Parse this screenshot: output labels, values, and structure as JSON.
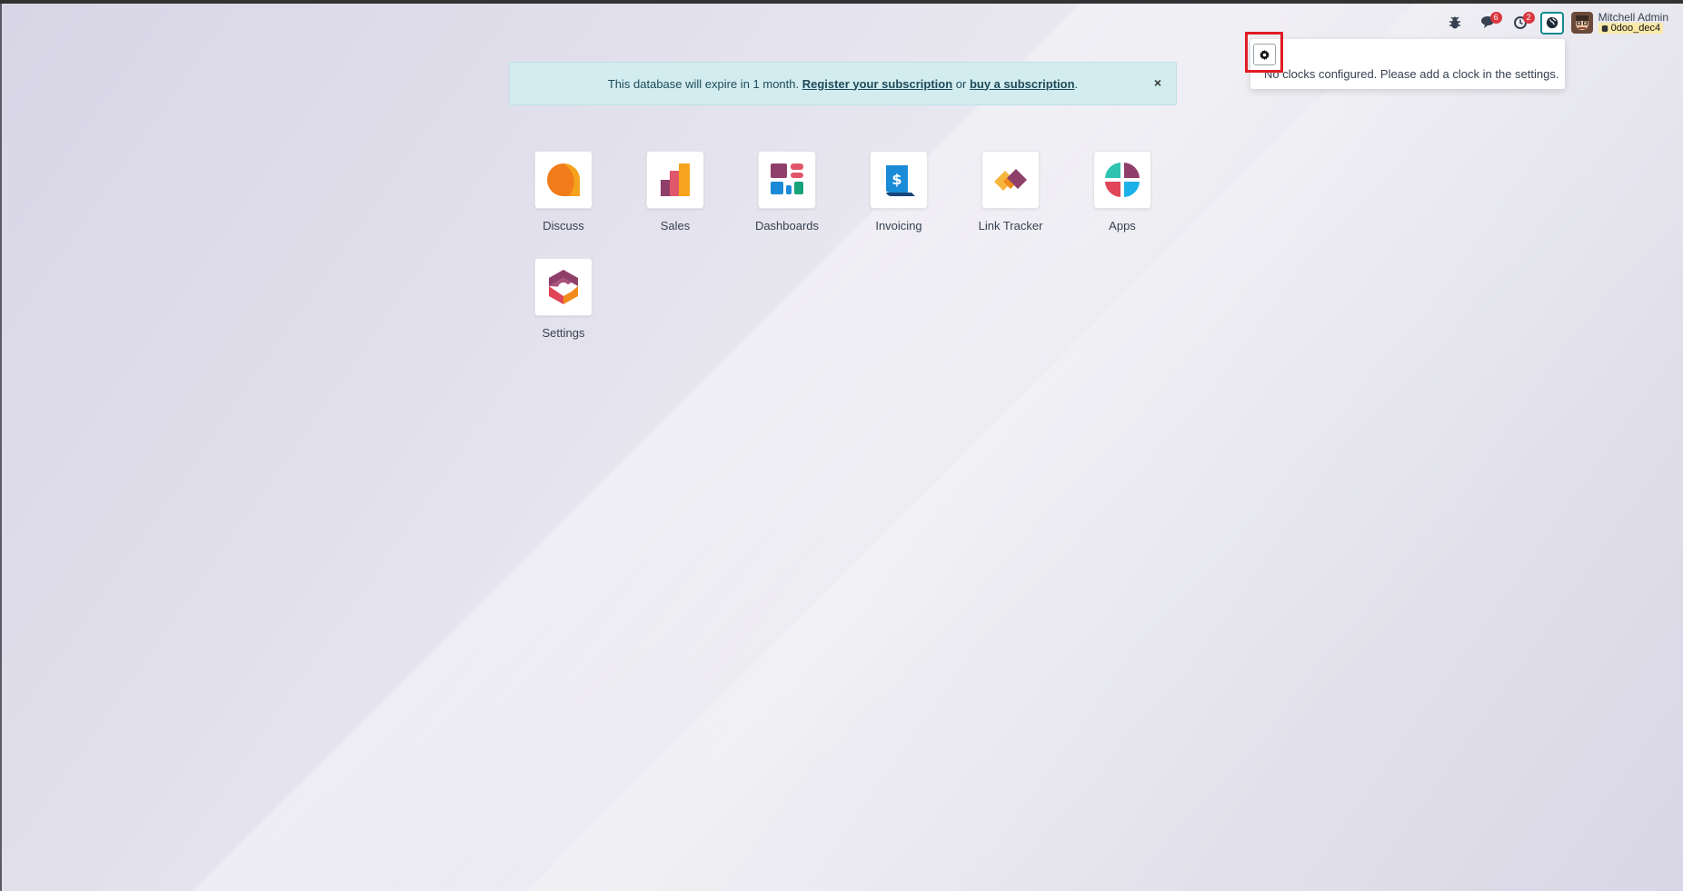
{
  "banner": {
    "text_before": "This database will expire in 1 month. ",
    "register_link": "Register your subscription",
    "middle": " or ",
    "buy_link": "buy a subscription",
    "text_after": ".",
    "close_label": "×"
  },
  "systray": {
    "bug_icon": "bug-icon",
    "chat_badge": "6",
    "activity_badge": "2",
    "user_name": "Mitchell Admin",
    "database": "0doo_dec4"
  },
  "clock_dropdown": {
    "message": "No clocks configured. Please add a clock in the settings."
  },
  "apps": [
    {
      "label": "Discuss",
      "icon": "discuss-icon"
    },
    {
      "label": "Sales",
      "icon": "sales-icon"
    },
    {
      "label": "Dashboards",
      "icon": "dashboards-icon"
    },
    {
      "label": "Invoicing",
      "icon": "invoicing-icon"
    },
    {
      "label": "Link Tracker",
      "icon": "link-tracker-icon"
    },
    {
      "label": "Apps",
      "icon": "apps-icon"
    },
    {
      "label": "Settings",
      "icon": "settings-icon"
    }
  ],
  "colors": {
    "banner_bg": "#d2ecef",
    "badge": "#d9363e",
    "highlight": "#e01b24",
    "accent_teal": "#0f8a92"
  }
}
